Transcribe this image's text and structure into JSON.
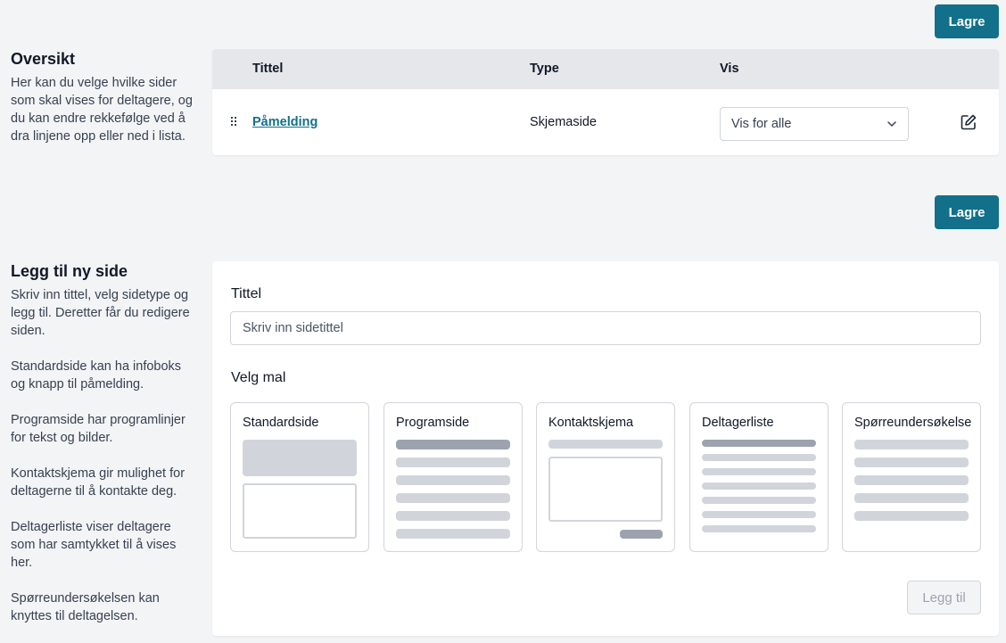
{
  "actions": {
    "save_label": "Lagre"
  },
  "overview": {
    "title": "Oversikt",
    "description": "Her kan du velge hvilke sider som skal vises for deltagere, og du kan endre rekkefølge ved å dra linjene opp eller ned i lista.",
    "columns": {
      "title": "Tittel",
      "type": "Type",
      "visibility": "Vis"
    },
    "rows": [
      {
        "title": "Påmelding",
        "type": "Skjemaside",
        "visibility": "Vis for alle"
      }
    ]
  },
  "add_page": {
    "title": "Legg til ny side",
    "descriptions": [
      "Skriv inn tittel, velg sidetype og legg til. Deretter får du redigere siden.",
      "Standardside kan ha infoboks og knapp til påmelding.",
      "Programside har programlinjer for tekst og bilder.",
      "Kontaktskjema gir mulighet for deltagerne til å kontakte deg.",
      "Deltagerliste viser deltagere som har samtykket til å vises her.",
      "Spørreundersøkelsen kan knyttes til deltagelsen."
    ],
    "title_label": "Tittel",
    "title_placeholder": "Skriv inn sidetittel",
    "title_value": "",
    "template_label": "Velg mal",
    "templates": [
      {
        "label": "Standardside"
      },
      {
        "label": "Programside"
      },
      {
        "label": "Kontaktskjema"
      },
      {
        "label": "Deltagerliste"
      },
      {
        "label": "Spørreundersøkelse"
      }
    ],
    "add_label": "Legg til"
  },
  "colors": {
    "primary": "#12708a",
    "background": "#f3f4f6",
    "table_header": "#e5e7eb",
    "placeholder_light": "#d1d5db",
    "placeholder_dark": "#9ca3af"
  },
  "icons": [
    "drag-handle-icon",
    "chevron-down-icon",
    "edit-icon"
  ]
}
